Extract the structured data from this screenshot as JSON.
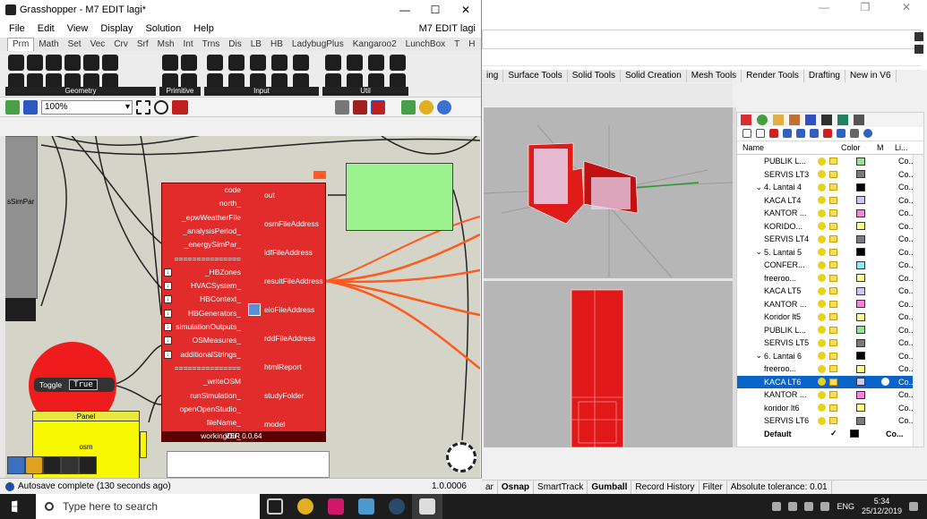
{
  "grasshopper": {
    "title": "Grasshopper - M7 EDIT lagi*",
    "window_controls": [
      "—",
      "☐",
      "✕"
    ],
    "menu": [
      "File",
      "Edit",
      "View",
      "Display",
      "Solution",
      "Help"
    ],
    "doc_name": "M7 EDIT lagi",
    "tabs": [
      "Prm",
      "Math",
      "Set",
      "Vec",
      "Crv",
      "Srf",
      "Msh",
      "Int",
      "Trns",
      "Dis",
      "LB",
      "HB",
      "LadybugPlus",
      "Kangaroo2",
      "LunchBox",
      "T",
      "H"
    ],
    "ribbon_groups": [
      "Geometry",
      "Primitive",
      "Input",
      "Util"
    ],
    "zoom": "100%",
    "status": "Autosave complete (130 seconds ago)",
    "version": "1.0.0006"
  },
  "canvas": {
    "simpar_label": "sSimPar",
    "hb_component": {
      "inputs": [
        "code",
        "north_",
        "_epwWeatherFile",
        "_analysisPeriod_",
        "_energySimPar_",
        "===============",
        "_HBZones",
        "HVACSystem_",
        "HBContext_",
        "HBGenerators_",
        "simulationOutputs_",
        "OSMeasures_",
        "additionalStrings_",
        "===============",
        "_writeOSM",
        "runSimulation_",
        "openOpenStudio_",
        "fileName_",
        "workingDir_"
      ],
      "outputs": [
        "out",
        "osmFileAddress",
        "idfFileAddress",
        "resultFileAddress",
        "eioFileAddress",
        "rddFileAddress",
        "htmlReport",
        "studyFolder",
        "model"
      ],
      "version": "VER 0.0.64"
    },
    "toggle": {
      "label": "Toggle",
      "value": "True"
    },
    "panel": {
      "header": "Panel",
      "value": "osm"
    }
  },
  "rhino": {
    "tabs": [
      "ing",
      "Surface Tools",
      "Solid Tools",
      "Solid Creation",
      "Mesh Tools",
      "Render Tools",
      "Drafting",
      "New in V6"
    ],
    "status": [
      "ar",
      "Osnap",
      "SmartTrack",
      "Gumball",
      "Record History",
      "Filter",
      "Absolute tolerance: 0.01"
    ]
  },
  "layers": {
    "headers": [
      "Name",
      "Color",
      "M",
      "Li..."
    ],
    "rows": [
      {
        "indent": "",
        "name": "PUBLIK L...",
        "color": "#8ee88e",
        "linetype": "Co...",
        "selected": false
      },
      {
        "indent": "",
        "name": "SERVIS LT3",
        "color": "#7a7a7a",
        "linetype": "Co...",
        "selected": false
      },
      {
        "indent": "⌄",
        "name": "4. Lantai 4",
        "color": "#000000",
        "linetype": "Co...",
        "selected": false
      },
      {
        "indent": "",
        "name": "KACA LT4",
        "color": "#c8c8ff",
        "linetype": "Co...",
        "selected": false
      },
      {
        "indent": "",
        "name": "KANTOR ...",
        "color": "#ff80e0",
        "linetype": "Co...",
        "selected": false
      },
      {
        "indent": "",
        "name": "KORIDO...",
        "color": "#ffff80",
        "linetype": "Co...",
        "selected": false
      },
      {
        "indent": "",
        "name": "SERVIS LT4",
        "color": "#7a7a7a",
        "linetype": "Co...",
        "selected": false
      },
      {
        "indent": "⌄",
        "name": "5. Lantai 5",
        "color": "#000000",
        "linetype": "Co...",
        "selected": false
      },
      {
        "indent": "",
        "name": "CONFER...",
        "color": "#80f0ff",
        "linetype": "Co...",
        "selected": false
      },
      {
        "indent": "",
        "name": "freeroo...",
        "color": "#ffff80",
        "linetype": "Co...",
        "selected": false
      },
      {
        "indent": "",
        "name": "KACA LT5",
        "color": "#c8c8ff",
        "linetype": "Co...",
        "selected": false
      },
      {
        "indent": "",
        "name": "KANTOR ...",
        "color": "#ff80e0",
        "linetype": "Co...",
        "selected": false
      },
      {
        "indent": "",
        "name": "Koridor lt5",
        "color": "#ffff80",
        "linetype": "Co...",
        "selected": false
      },
      {
        "indent": "",
        "name": "PUBLIK L...",
        "color": "#8ee88e",
        "linetype": "Co...",
        "selected": false
      },
      {
        "indent": "",
        "name": "SERVIS LT5",
        "color": "#7a7a7a",
        "linetype": "Co...",
        "selected": false
      },
      {
        "indent": "⌄",
        "name": "6. Lantai 6",
        "color": "#000000",
        "linetype": "Co...",
        "selected": false
      },
      {
        "indent": "",
        "name": "freeroo...",
        "color": "#ffff80",
        "linetype": "Co...",
        "selected": false
      },
      {
        "indent": "",
        "name": "KACA LT6",
        "color": "#c8c8ff",
        "linetype": "Co...",
        "selected": true
      },
      {
        "indent": "",
        "name": "KANTOR ...",
        "color": "#ff80e0",
        "linetype": "Co...",
        "selected": false
      },
      {
        "indent": "",
        "name": "koridor lt6",
        "color": "#ffff80",
        "linetype": "Co...",
        "selected": false
      },
      {
        "indent": "",
        "name": "SERVIS LT6",
        "color": "#7a7a7a",
        "linetype": "Co...",
        "selected": false
      }
    ],
    "default_row": {
      "name": "Default",
      "check": "✓",
      "linetype": "Co..."
    }
  },
  "taskbar": {
    "search_placeholder": "Type here to search",
    "apps": [
      "chrome-icon",
      "indesign-icon",
      "photos-icon",
      "steam-icon",
      "grasshopper-icon"
    ],
    "language": "ENG",
    "time": "5:34",
    "date": "25/12/2019"
  }
}
